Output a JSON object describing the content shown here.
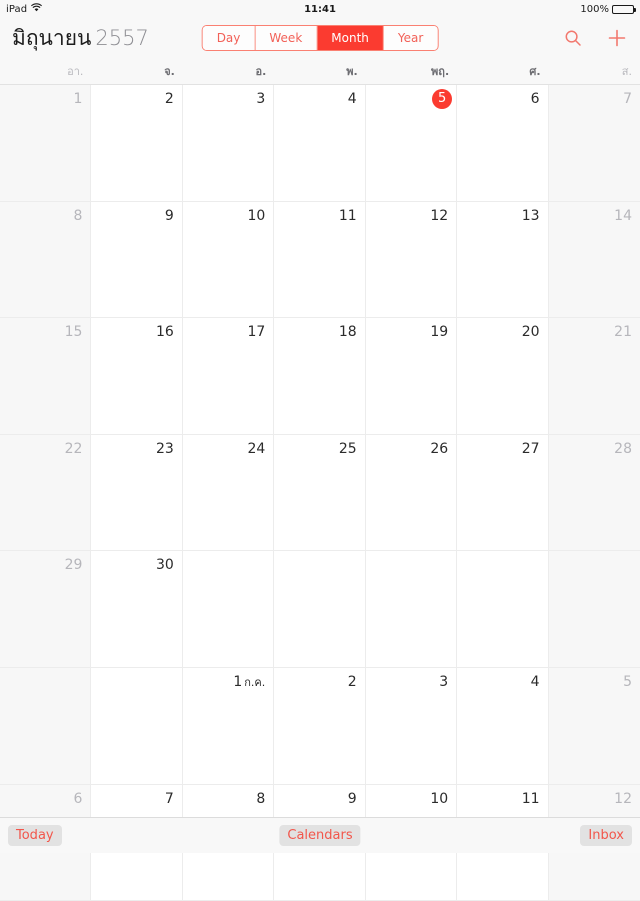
{
  "status_bar": {
    "device": "iPad",
    "wifi_icon": "wifi-icon",
    "time": "11:41",
    "battery_percent": "100%",
    "battery_icon": "battery-full-icon"
  },
  "nav_bar": {
    "month_title": "มิถุนายน",
    "year_title": "2557",
    "segments": [
      {
        "label": "Day",
        "selected": false
      },
      {
        "label": "Week",
        "selected": false
      },
      {
        "label": "Month",
        "selected": true
      },
      {
        "label": "Year",
        "selected": false
      }
    ],
    "search_icon": "search-icon",
    "add_icon": "plus-icon"
  },
  "weekdays": [
    {
      "label": "อา.",
      "weekend": true
    },
    {
      "label": "จ.",
      "weekend": false
    },
    {
      "label": "อ.",
      "weekend": false
    },
    {
      "label": "พ.",
      "weekend": false
    },
    {
      "label": "พฤ.",
      "weekend": false
    },
    {
      "label": "ศ.",
      "weekend": false
    },
    {
      "label": "ส.",
      "weekend": true
    }
  ],
  "calendar": {
    "weeks": [
      [
        {
          "day": "1",
          "weekend": true,
          "other_month": false,
          "today": false
        },
        {
          "day": "2",
          "weekend": false,
          "other_month": false,
          "today": false
        },
        {
          "day": "3",
          "weekend": false,
          "other_month": false,
          "today": false
        },
        {
          "day": "4",
          "weekend": false,
          "other_month": false,
          "today": false
        },
        {
          "day": "5",
          "weekend": false,
          "other_month": false,
          "today": true
        },
        {
          "day": "6",
          "weekend": false,
          "other_month": false,
          "today": false
        },
        {
          "day": "7",
          "weekend": true,
          "other_month": false,
          "today": false
        }
      ],
      [
        {
          "day": "8",
          "weekend": true,
          "other_month": false,
          "today": false
        },
        {
          "day": "9",
          "weekend": false,
          "other_month": false,
          "today": false
        },
        {
          "day": "10",
          "weekend": false,
          "other_month": false,
          "today": false
        },
        {
          "day": "11",
          "weekend": false,
          "other_month": false,
          "today": false
        },
        {
          "day": "12",
          "weekend": false,
          "other_month": false,
          "today": false
        },
        {
          "day": "13",
          "weekend": false,
          "other_month": false,
          "today": false
        },
        {
          "day": "14",
          "weekend": true,
          "other_month": false,
          "today": false
        }
      ],
      [
        {
          "day": "15",
          "weekend": true,
          "other_month": false,
          "today": false
        },
        {
          "day": "16",
          "weekend": false,
          "other_month": false,
          "today": false
        },
        {
          "day": "17",
          "weekend": false,
          "other_month": false,
          "today": false
        },
        {
          "day": "18",
          "weekend": false,
          "other_month": false,
          "today": false
        },
        {
          "day": "19",
          "weekend": false,
          "other_month": false,
          "today": false
        },
        {
          "day": "20",
          "weekend": false,
          "other_month": false,
          "today": false
        },
        {
          "day": "21",
          "weekend": true,
          "other_month": false,
          "today": false
        }
      ],
      [
        {
          "day": "22",
          "weekend": true,
          "other_month": false,
          "today": false
        },
        {
          "day": "23",
          "weekend": false,
          "other_month": false,
          "today": false
        },
        {
          "day": "24",
          "weekend": false,
          "other_month": false,
          "today": false
        },
        {
          "day": "25",
          "weekend": false,
          "other_month": false,
          "today": false
        },
        {
          "day": "26",
          "weekend": false,
          "other_month": false,
          "today": false
        },
        {
          "day": "27",
          "weekend": false,
          "other_month": false,
          "today": false
        },
        {
          "day": "28",
          "weekend": true,
          "other_month": false,
          "today": false
        }
      ],
      [
        {
          "day": "29",
          "weekend": true,
          "other_month": false,
          "today": false
        },
        {
          "day": "30",
          "weekend": false,
          "other_month": false,
          "today": false
        },
        {
          "day": "",
          "weekend": false,
          "other_month": false,
          "today": false
        },
        {
          "day": "",
          "weekend": false,
          "other_month": false,
          "today": false
        },
        {
          "day": "",
          "weekend": false,
          "other_month": false,
          "today": false
        },
        {
          "day": "",
          "weekend": false,
          "other_month": false,
          "today": false
        },
        {
          "day": "",
          "weekend": true,
          "other_month": false,
          "today": false
        }
      ],
      [
        {
          "day": "",
          "weekend": true,
          "other_month": false,
          "today": false
        },
        {
          "day": "",
          "weekend": false,
          "other_month": false,
          "today": false
        },
        {
          "day": "1",
          "month_tag": "ก.ค.",
          "weekend": false,
          "other_month": false,
          "today": false
        },
        {
          "day": "2",
          "weekend": false,
          "other_month": false,
          "today": false
        },
        {
          "day": "3",
          "weekend": false,
          "other_month": false,
          "today": false
        },
        {
          "day": "4",
          "weekend": false,
          "other_month": false,
          "today": false
        },
        {
          "day": "5",
          "weekend": true,
          "other_month": false,
          "today": false
        }
      ],
      [
        {
          "day": "6",
          "weekend": true,
          "other_month": false,
          "today": false
        },
        {
          "day": "7",
          "weekend": false,
          "other_month": false,
          "today": false
        },
        {
          "day": "8",
          "weekend": false,
          "other_month": false,
          "today": false
        },
        {
          "day": "9",
          "weekend": false,
          "other_month": false,
          "today": false
        },
        {
          "day": "10",
          "weekend": false,
          "other_month": false,
          "today": false
        },
        {
          "day": "11",
          "weekend": false,
          "other_month": false,
          "today": false
        },
        {
          "day": "12",
          "weekend": true,
          "other_month": false,
          "today": false
        }
      ]
    ]
  },
  "toolbar": {
    "today_label": "Today",
    "calendars_label": "Calendars",
    "inbox_label": "Inbox"
  },
  "colors": {
    "accent_red": "#fb3b30",
    "tint_red": "#f2564b",
    "bar_bg": "#f8f8f8",
    "weekend_bg": "#f7f7f7",
    "grid_line": "#ececec"
  }
}
